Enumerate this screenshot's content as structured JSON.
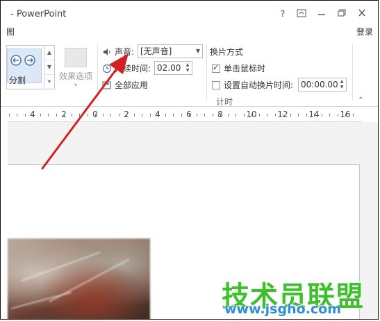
{
  "window": {
    "title": "- PowerPoint",
    "help": "?",
    "controls": [
      "ribbon-display-options",
      "minimize",
      "restore",
      "close"
    ]
  },
  "tabs": {
    "left_partial": "图",
    "login": "登录"
  },
  "ribbon": {
    "gallery": {
      "item_label": "分割"
    },
    "effect_options": {
      "label": "效果选项"
    },
    "timing": {
      "sound_label": "声音:",
      "sound_value": "[无声音]",
      "duration_label": "持续时间:",
      "duration_value": "02.00",
      "apply_all_label": "全部应用"
    },
    "advance": {
      "title": "换片方式",
      "on_click_label": "单击鼠标时",
      "on_click_checked": true,
      "after_label": "设置自动换片时间:",
      "after_checked": false,
      "after_value": "00:00.00"
    },
    "group_label": "计时"
  },
  "ruler": {
    "labels": [
      "4",
      "2",
      "0",
      "2",
      "4",
      "6",
      "8",
      "10",
      "12",
      "14",
      "16"
    ]
  },
  "watermark": {
    "brand": "技术员联盟",
    "url": "www.jsgho.com"
  },
  "colors": {
    "annotation_arrow": "#d42020",
    "watermark_green": "#3fbf2e",
    "watermark_blue": "#2f8fd6"
  }
}
